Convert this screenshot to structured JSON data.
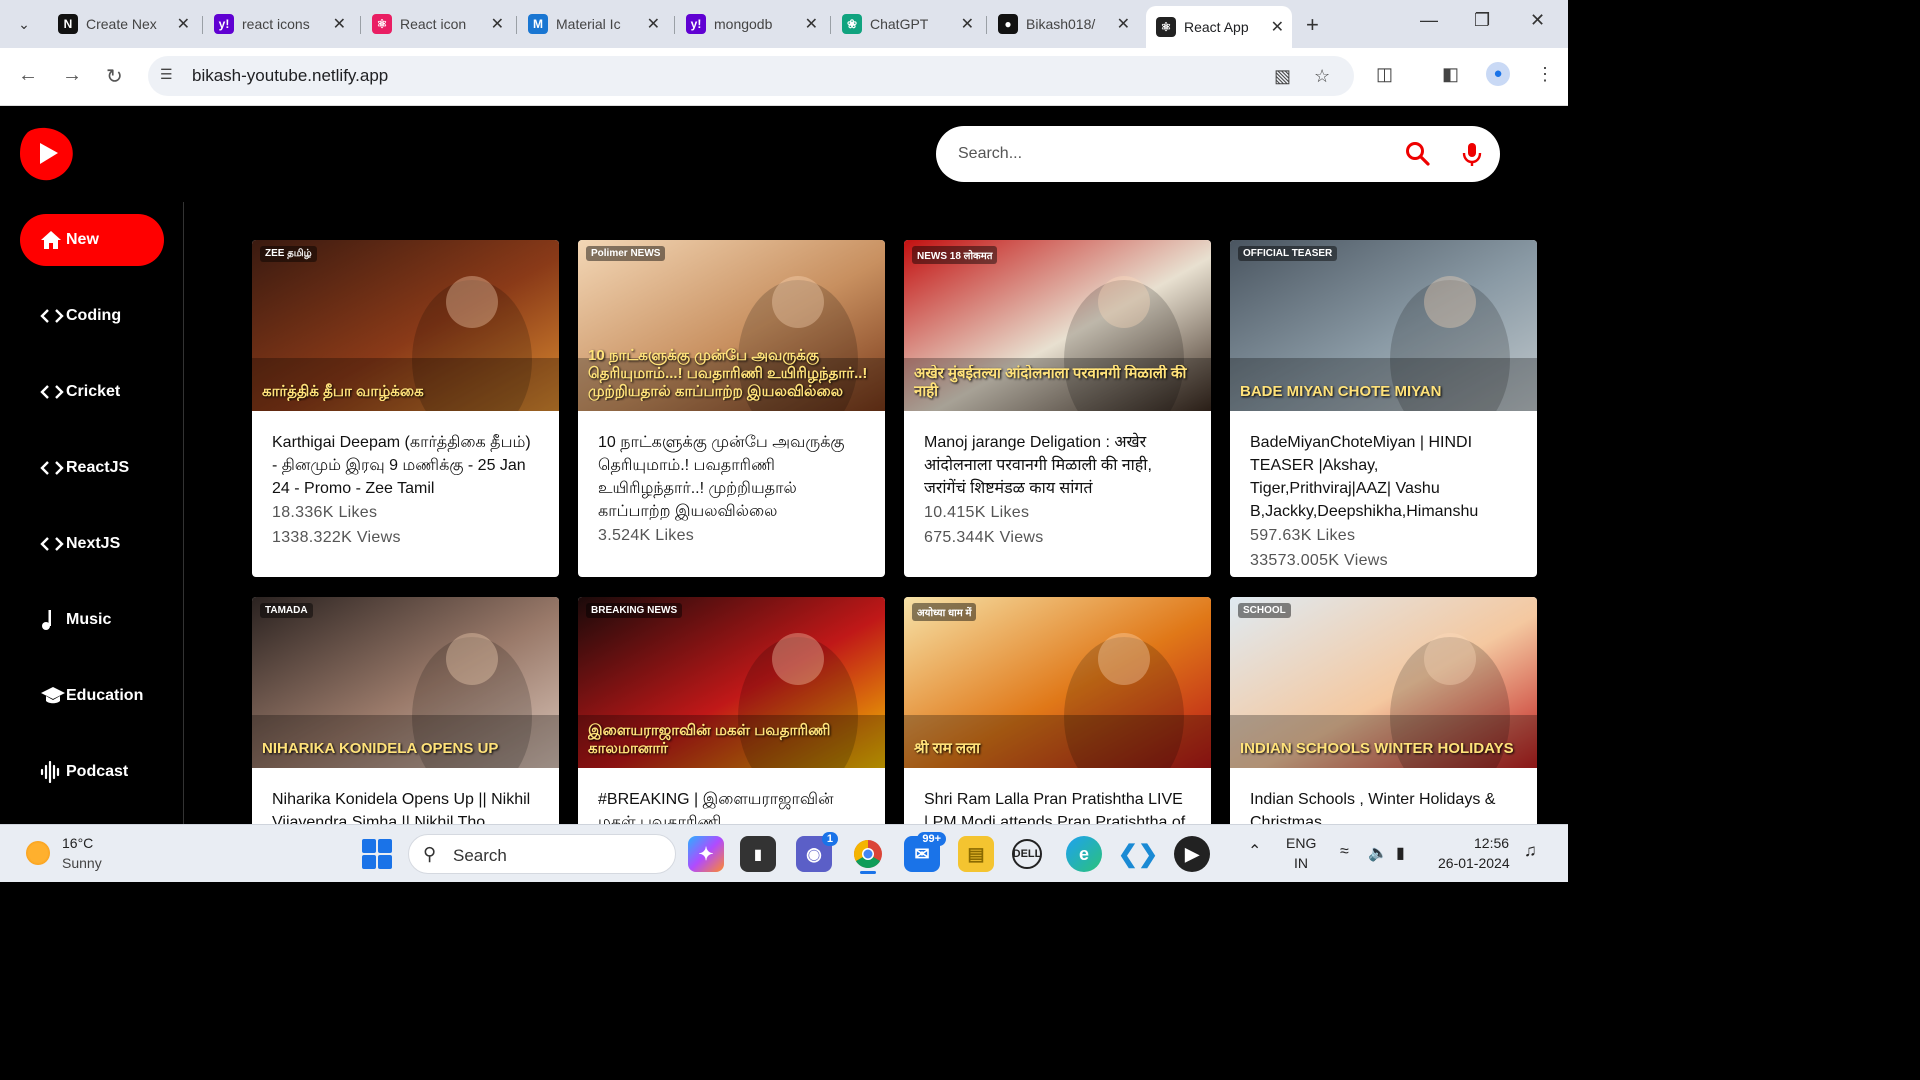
{
  "browser": {
    "tabs": [
      {
        "title": "Create Nex",
        "icon": "nextjs-icon",
        "active": false
      },
      {
        "title": "react icons",
        "icon": "yahoo-icon",
        "active": false
      },
      {
        "title": "React icon",
        "icon": "react-icons-icon",
        "active": false
      },
      {
        "title": "Material Ic",
        "icon": "mui-icon",
        "active": false
      },
      {
        "title": "mongodb",
        "icon": "yahoo-icon",
        "active": false
      },
      {
        "title": "ChatGPT",
        "icon": "chatgpt-icon",
        "active": false
      },
      {
        "title": "Bikash018/",
        "icon": "github-icon",
        "active": false
      },
      {
        "title": "React App",
        "icon": "react-icon",
        "active": true
      }
    ],
    "url": "bikash-youtube.netlify.app"
  },
  "app": {
    "search": {
      "placeholder": "Search..."
    },
    "sidebar": [
      {
        "label": "New",
        "icon": "home-icon",
        "active": true
      },
      {
        "label": "Coding",
        "icon": "code-icon",
        "active": false
      },
      {
        "label": "Cricket",
        "icon": "code-icon",
        "active": false
      },
      {
        "label": "ReactJS",
        "icon": "code-icon",
        "active": false
      },
      {
        "label": "NextJS",
        "icon": "code-icon",
        "active": false
      },
      {
        "label": "Music",
        "icon": "music-note-icon",
        "active": false
      },
      {
        "label": "Education",
        "icon": "graduation-cap-icon",
        "active": false
      },
      {
        "label": "Podcast",
        "icon": "audio-wave-icon",
        "active": false
      }
    ],
    "videos": [
      {
        "title": "Karthigai Deepam (கார்த்திகை தீபம்) - தினமும் இரவு 9 மணிக்கு - 25 Jan 24 - Promo - Zee Tamil",
        "likes": "18.336K Likes",
        "views": "1338.322K Views",
        "thumb_text": "கார்த்திக் தீபா வாழ்க்கை",
        "thumb_badge": "ZEE தமிழ்",
        "palette": [
          "#3a1a10",
          "#8a3a18",
          "#d98a30"
        ]
      },
      {
        "title": "10 நாட்களுக்கு முன்பே அவருக்கு தெரியுமாம்.! பவதாரிணி உயிரிழந்தார்..! முற்றியதால் காப்பாற்ற இயலவில்லை",
        "likes": "3.524K Likes",
        "views": "",
        "thumb_text": "10 நாட்களுக்கு முன்பே அவருக்கு தெரியுமாம்...! பவதாரிணி உயிரிழந்தார்..! முற்றியதால் காப்பாற்ற இயலவில்லை",
        "thumb_badge": "Polimer NEWS",
        "palette": [
          "#f3d7b6",
          "#c89060",
          "#7a3a1a"
        ]
      },
      {
        "title": "Manoj jarange Deligation : अखेर आंदोलनाला परवानगी मिळाली की नाही, जरांगेंचं शिष्टमंडळ काय सांगतं",
        "likes": "10.415K Likes",
        "views": "675.344K Views",
        "thumb_text": "अखेर मुंबईतल्या आंदोलनाला परवानगी मिळाली की नाही",
        "thumb_badge": "NEWS 18 लोकमत",
        "palette": [
          "#c21010",
          "#e8e0d0",
          "#3a2a20"
        ]
      },
      {
        "title": "BadeMiyanChoteMiyan | HINDI TEASER |Akshay, Tiger,Prithviraj|AAZ| Vashu B,Jackky,Deepshikha,Himanshu",
        "likes": "597.63K Likes",
        "views": "33573.005K Views",
        "thumb_text": "BADE MIYAN CHOTE MIYAN",
        "thumb_badge": "OFFICIAL TEASER",
        "palette": [
          "#4a5560",
          "#8a9aa5",
          "#c0c8cc"
        ]
      },
      {
        "title": "Niharika Konidela Opens Up || Nikhil Vijayendra Simha || Nikhil Tho",
        "likes": "",
        "views": "",
        "thumb_text": "NIHARIKA KONIDELA OPENS UP",
        "thumb_badge": "TAMADA",
        "palette": [
          "#2a2220",
          "#9a7a6a",
          "#d9c4b8"
        ]
      },
      {
        "title": "#BREAKING | இளையராஜாவின் மகள் பவதாரிணி",
        "likes": "",
        "views": "",
        "thumb_text": "இளையராஜாவின் மகள் பவதாரிணி காலமானார்",
        "thumb_badge": "BREAKING NEWS",
        "palette": [
          "#1a0a0a",
          "#c01818",
          "#f2c000"
        ]
      },
      {
        "title": "Shri Ram Lalla Pran Pratishtha LIVE | PM Modi attends Pran Pratishtha of",
        "likes": "",
        "views": "",
        "thumb_text": "श्री राम लला",
        "thumb_badge": "अयोध्या धाम में",
        "palette": [
          "#f6e2a8",
          "#e07818",
          "#b81818"
        ]
      },
      {
        "title": "Indian Schools , Winter Holidays & Christmas",
        "likes": "",
        "views": "",
        "thumb_text": "INDIAN SCHOOLS WINTER HOLIDAYS",
        "thumb_badge": "SCHOOL",
        "palette": [
          "#dfeaf2",
          "#f4c8a0",
          "#c02020"
        ]
      }
    ]
  },
  "taskbar": {
    "temperature": "16°C",
    "condition": "Sunny",
    "search_label": "Search",
    "language": "ENG",
    "region": "IN",
    "time": "12:56",
    "date": "26-01-2024",
    "mail_badge": "99+",
    "teams_badge": "1",
    "apps": [
      "copilot-icon",
      "terminal-icon",
      "teams-icon",
      "chrome-icon",
      "mail-icon",
      "file-explorer-icon",
      "dell-icon",
      "edge-icon",
      "vscode-icon",
      "media-player-icon"
    ]
  }
}
